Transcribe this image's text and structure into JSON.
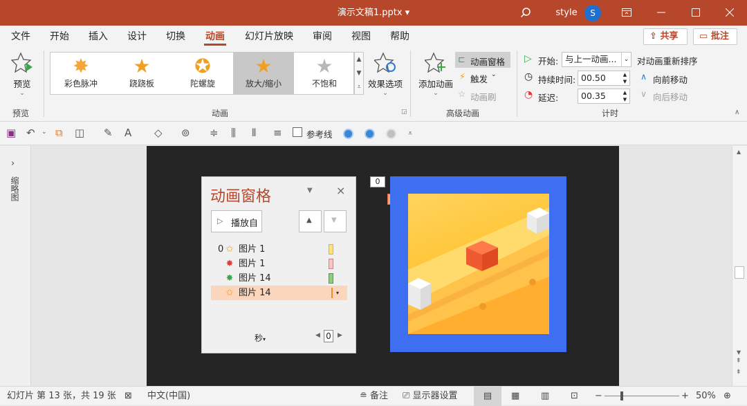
{
  "titlebar": {
    "title": "演示文稿1.pptx",
    "dropdown": "▾",
    "user": "style",
    "avatar": "S"
  },
  "menu": {
    "tabs": [
      "文件",
      "开始",
      "插入",
      "设计",
      "切换",
      "动画",
      "幻灯片放映",
      "审阅",
      "视图",
      "帮助"
    ],
    "share": "共享",
    "comment": "批注"
  },
  "ribbon": {
    "preview": {
      "label": "预览",
      "group": "预览"
    },
    "animations": [
      {
        "label": "彩色脉冲",
        "color": "#f4a638"
      },
      {
        "label": "跷跷板",
        "color": "#f0a020"
      },
      {
        "label": "陀螺旋",
        "color": "#f0a020"
      },
      {
        "label": "放大/缩小",
        "color": "#f0a020"
      },
      {
        "label": "不饱和",
        "color": "#c8c8c8"
      }
    ],
    "effect_options": "效果选项",
    "group_animation": "动画",
    "add_animation": "添加动画",
    "animation_pane_btn": "动画窗格",
    "trigger": "触发",
    "animation_painter": "动画刷",
    "group_advanced": "高级动画",
    "start_label": "开始:",
    "start_value": "与上一动画...",
    "duration_label": "持续时间:",
    "duration_value": "00.50",
    "delay_label": "延迟:",
    "delay_value": "00.35",
    "group_timing": "计时",
    "reorder_title": "对动画重新排序",
    "move_earlier": "向前移动",
    "move_later": "向后移动"
  },
  "qat": {
    "guides": "参考线"
  },
  "leftpanel": {
    "label": "缩略图"
  },
  "anim_pane": {
    "title": "动画窗格",
    "play_btn": "播放自",
    "items": [
      {
        "prefix": "0",
        "name": "图片 1",
        "bar": "#ffe27a",
        "icon_color": "#f0a020"
      },
      {
        "prefix": "",
        "name": "图片 1",
        "bar": "#f8c6c4",
        "icon_color": "#e03a3a"
      },
      {
        "prefix": "",
        "name": "图片 14",
        "bar": "#8bd17c",
        "icon_color": "#3aa64a"
      },
      {
        "prefix": "",
        "name": "图片 14",
        "bar": "#ffc48a",
        "icon_color": "#f0a020"
      }
    ],
    "seconds": "秒",
    "page": "0"
  },
  "slide": {
    "tag1": "0",
    "tag2": "0"
  },
  "status": {
    "slide_info": "幻灯片 第 13 张，共 19 张",
    "language": "中文(中国)",
    "notes": "备注",
    "display": "显示器设置",
    "zoom": "50%"
  },
  "colors": {
    "accent": "#b7472a",
    "slide_bg": "#3d6ff0"
  }
}
